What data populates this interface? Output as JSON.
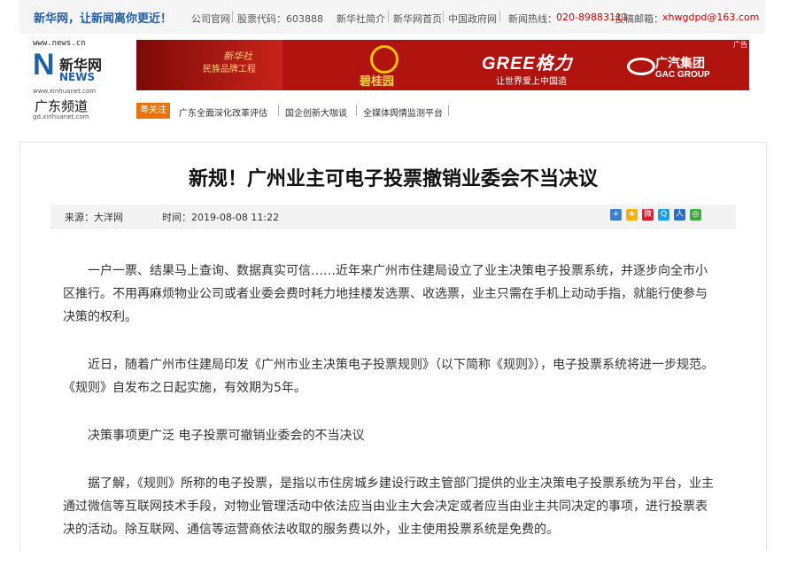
{
  "topbar": {
    "slogan": "新华网，让新闻离你更近！",
    "company_site": "公司官网",
    "stock_code": "股票代码：603888",
    "links": [
      "新华社简介",
      "新华网首页",
      "中国政府网"
    ],
    "hotline_label": "新闻热线：",
    "hotline": "020-89883111",
    "contact_label": "投稿邮箱：",
    "email": "xhwgdpd@163.com"
  },
  "logo": {
    "site": "www.news.cn",
    "brand_cn": "新华网",
    "brand_en": "NEWS",
    "site2": "www.xinhuanet.com",
    "channel": "广东频道",
    "channel_url": "gd.xinhuanet.com"
  },
  "banner": {
    "ad_label": "广告",
    "ad1_line1": "新华社",
    "ad1_line2": "民族品牌工程",
    "ad2": "碧桂园",
    "ad3_logo": "GREE格力",
    "ad3_slogan": "让世界爱上中国造",
    "ad4_cn": "广汽集团",
    "ad4_en": "GAC GROUP"
  },
  "nav": {
    "hot": "粤关注",
    "items": [
      "广东全面深化改革评估",
      "国企创新大咖谈",
      "全媒体舆情监测平台"
    ]
  },
  "article": {
    "title": "新规！广州业主可电子投票撤销业委会不当决议",
    "source_label": "来源：",
    "source": "大洋网",
    "time_label": "时间：",
    "time": "2019-08-08 11:22",
    "paragraphs": [
      "一户一票、结果马上查询、数据真实可信……近年来广州市住建局设立了业主决策电子投票系统，并逐步向全市小区推行。不用再麻烦物业公司或者业委会费时耗力地挂楼发选票、收选票，业主只需在手机上动动手指，就能行使参与决策的权利。",
      "近日，随着广州市住建局印发《广州市业主决策电子投票规则》（以下简称《规则》），电子投票系统将进一步规范。《规则》自发布之日起实施，有效期为5年。",
      "决策事项更广泛 电子投票可撤销业委会的不当决议",
      "据了解，《规则》所称的电子投票，是指以市住房城乡建设行政主管部门提供的业主决策电子投票系统为平台，业主通过微信等互联网技术手段，对物业管理活动中依法应当由业主大会决定或者应当由业主共同决定的事项，进行投票表决的活动。除互联网、通信等运营商依法收取的服务费以外，业主使用投票系统是免费的。"
    ]
  },
  "share_icons": [
    "share-plus-icon",
    "qzone-icon",
    "weibo-icon",
    "qq-icon",
    "renren-icon",
    "wechat-icon"
  ],
  "colors": {
    "brand_blue": "#1f5fa8",
    "accent_red": "#d60000",
    "hot_orange": "#e8720c",
    "banner_red": "#b1140f"
  }
}
